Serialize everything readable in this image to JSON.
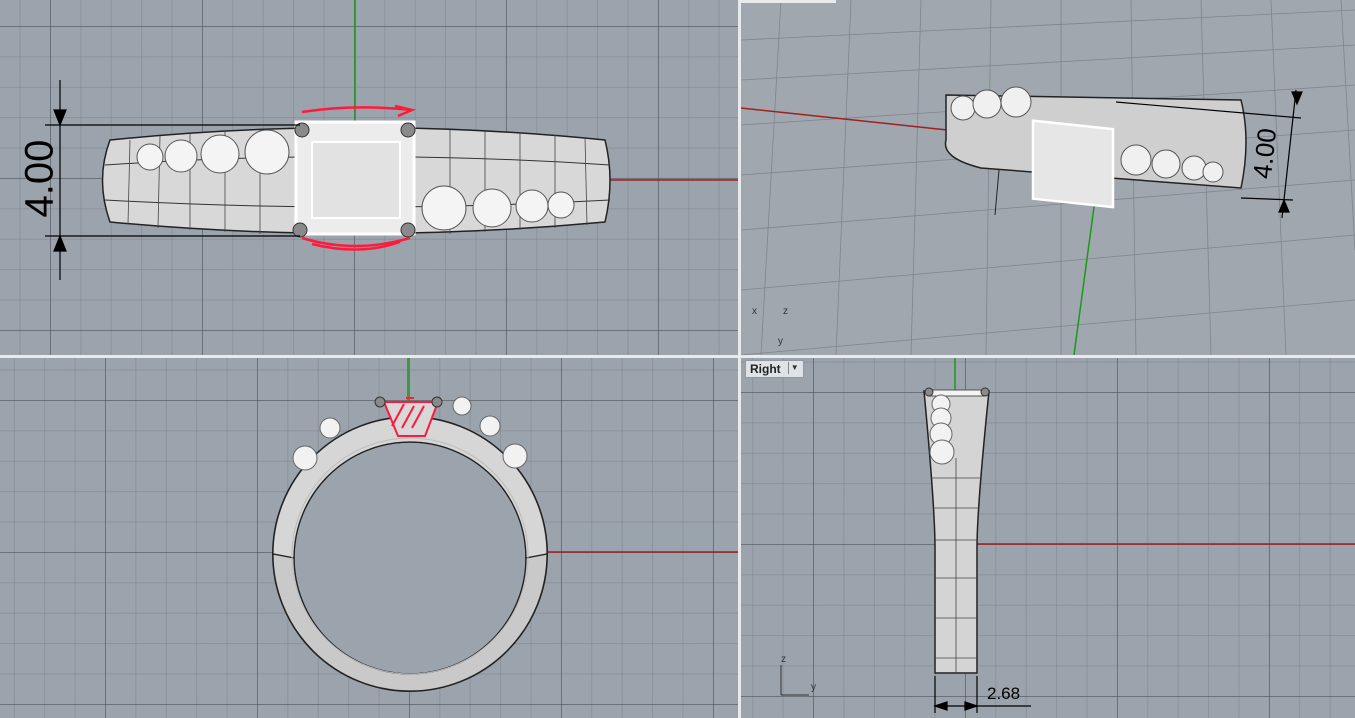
{
  "viewports": {
    "top": {
      "dimension": "4.00"
    },
    "perspective": {
      "dimension": "4.00",
      "axes": {
        "x": "x",
        "y": "y",
        "z": "z"
      }
    },
    "front": {},
    "right": {
      "tab_label": "Right",
      "dimension": "2.68",
      "axes": {
        "y": "y",
        "z": "z"
      }
    }
  },
  "colors": {
    "x_axis": "#a02020",
    "y_axis": "#1a9a1a",
    "markup": "#ff1a3c",
    "grid_bg": "#9ba3ac"
  }
}
